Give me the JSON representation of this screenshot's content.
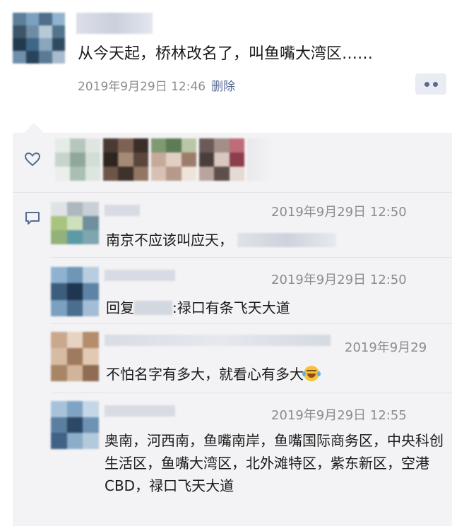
{
  "post": {
    "text": "从今天起，桥林改名了，叫鱼嘴大湾区……",
    "time": "2019年9月29日 12:46",
    "delete_label": "删除"
  },
  "comments": [
    {
      "time": "2019年9月29日 12:50",
      "text": "南京不应该叫应天，"
    },
    {
      "time": "2019年9月29日 12:50",
      "reply_prefix": "回复",
      "text": ":禄口有条飞天大道"
    },
    {
      "time": "2019年9月29",
      "text": "不怕名字有多大，就看心有多大"
    },
    {
      "time": "2019年9月29日 12:55",
      "text": "奥南，河西南，鱼嘴南岸，鱼嘴国际商务区，中央科创生活区，鱼嘴大湾区，北外滩特区，紫东新区，空港CBD，禄口飞天大道"
    }
  ],
  "icons": {
    "like": "heart-icon",
    "comment": "comment-icon",
    "more": "more-dots-icon",
    "emoji": "laughing-tears-emoji-icon"
  },
  "colors": {
    "link": "#576b95",
    "meta": "#8c8c8c",
    "panel": "#f3f3f5"
  }
}
